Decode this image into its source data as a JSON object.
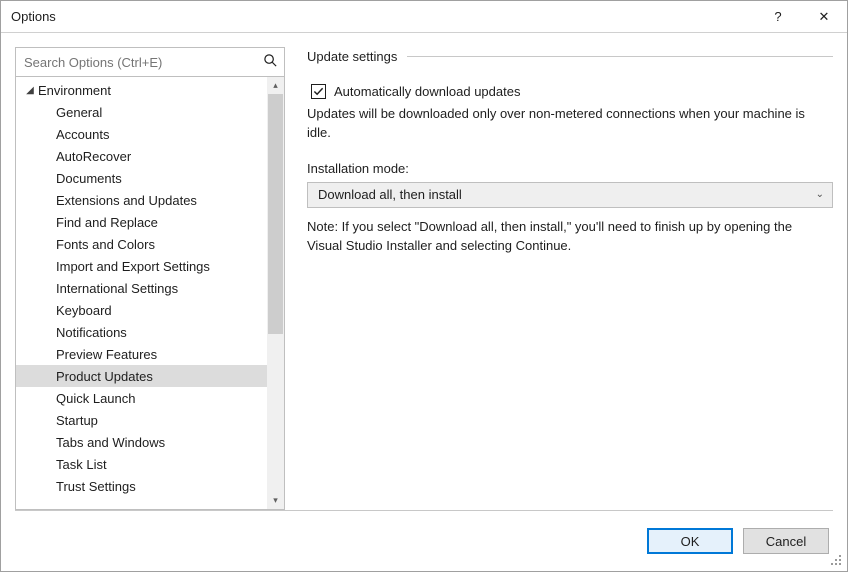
{
  "window": {
    "title": "Options"
  },
  "search": {
    "placeholder": "Search Options (Ctrl+E)"
  },
  "tree": {
    "root": "Environment",
    "items": [
      "General",
      "Accounts",
      "AutoRecover",
      "Documents",
      "Extensions and Updates",
      "Find and Replace",
      "Fonts and Colors",
      "Import and Export Settings",
      "International Settings",
      "Keyboard",
      "Notifications",
      "Preview Features",
      "Product Updates",
      "Quick Launch",
      "Startup",
      "Tabs and Windows",
      "Task List",
      "Trust Settings"
    ],
    "selected": "Product Updates"
  },
  "content": {
    "section_title": "Update settings",
    "checkbox_label": "Automatically download updates",
    "checkbox_checked": true,
    "description": "Updates will be downloaded only over non-metered connections when your machine is idle.",
    "install_mode_label": "Installation mode:",
    "install_mode_value": "Download all, then install",
    "note": "Note: If you select \"Download all, then install,\" you'll need to finish up by opening the Visual Studio Installer and selecting Continue."
  },
  "footer": {
    "ok": "OK",
    "cancel": "Cancel"
  }
}
